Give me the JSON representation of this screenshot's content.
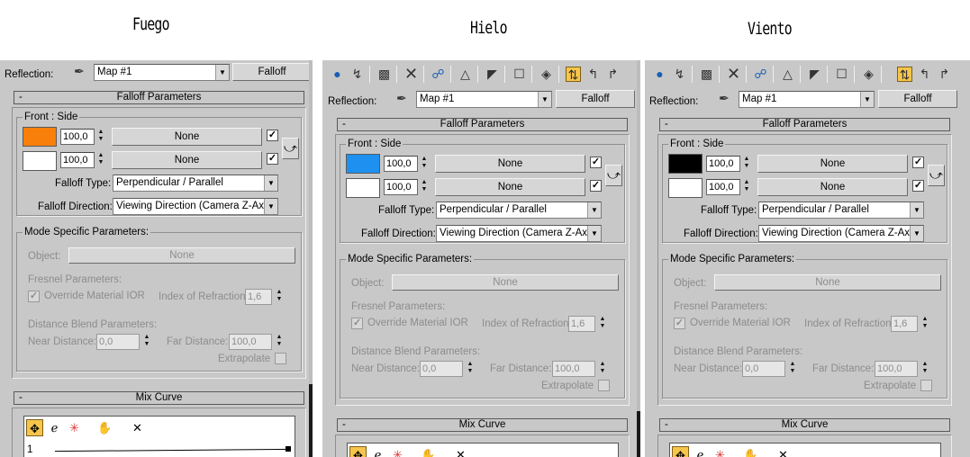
{
  "titles": {
    "fuego": "Fuego",
    "hielo": "Hielo",
    "viento": "Viento"
  },
  "panel": {
    "reflection_label": "Reflection:",
    "map_value": "Map #1",
    "falloff_button": "Falloff",
    "falloff_params_title": "Falloff Parameters",
    "front_side_label": "Front : Side",
    "spinner_value": "100,0",
    "none_label": "None",
    "falloff_type_label": "Falloff Type:",
    "falloff_type_value": "Perpendicular / Parallel",
    "falloff_direction_label": "Falloff Direction:",
    "falloff_direction_value": "Viewing Direction (Camera Z-Axis)",
    "mode_specific_label": "Mode Specific Parameters:",
    "object_label": "Object:",
    "object_value": "None",
    "fresnel_label": "Fresnel Parameters:",
    "override_ior_label": "Override Material IOR",
    "ior_label": "Index of Refraction",
    "ior_value": "1,6",
    "distance_blend_label": "Distance Blend Parameters:",
    "near_distance_label": "Near Distance:",
    "near_distance_value": "0,0",
    "far_distance_label": "Far Distance:",
    "far_distance_value": "100,0",
    "extrapolate_label": "Extrapolate",
    "mix_curve_title": "Mix Curve",
    "curve_point_label": "1"
  },
  "colors": {
    "fuego_front": "#f77f0a",
    "hielo_front": "#1e90f0",
    "viento_front": "#000000",
    "side": "#ffffff"
  },
  "icons": {
    "toolbar": [
      "get-material-icon",
      "put-to-scene-icon",
      "assign-to-selection-icon",
      "reset-map-icon",
      "make-unique-icon",
      "show-end-result-icon",
      "go-to-parent-icon",
      "copy-map-icon",
      "put-to-library-icon",
      "material-effects-channel-icon",
      "show-map-in-viewport-icon",
      "show-end-result-active-icon",
      "go-to-parent-icon-2",
      "go-forward-icon"
    ],
    "curve_tools": [
      "move-icon",
      "scale-point-icon",
      "add-point-icon",
      "hand-icon",
      "delete-point-icon"
    ]
  }
}
